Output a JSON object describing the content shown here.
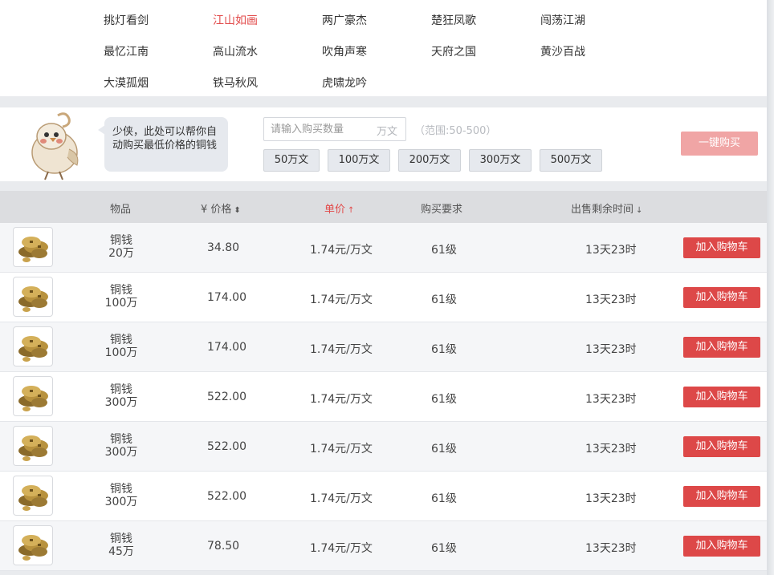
{
  "servers": [
    "挑灯看剑",
    "江山如画",
    "两广豪杰",
    "楚狂凤歌",
    "闯荡江湖",
    "最忆江南",
    "高山流水",
    "吹角声寒",
    "天府之国",
    "黄沙百战",
    "大漠孤烟",
    "铁马秋风",
    "虎啸龙吟"
  ],
  "active_server": "江山如画",
  "autobuy": {
    "tip": "少侠，此处可以帮你自动购买最低价格的铜钱",
    "placeholder": "请输入购买数量",
    "unit": "万文",
    "range": "（范围:50-500）",
    "amounts": [
      "50万文",
      "100万文",
      "200万文",
      "300万文",
      "500万文"
    ],
    "onekey_label": "一键购买"
  },
  "table": {
    "headers": {
      "item": "物品",
      "price": "¥ 价格",
      "unit_price": "单价",
      "requirement": "购买要求",
      "remaining": "出售剩余时间"
    },
    "sort_icons": {
      "price": "sort-both-icon",
      "unit_price": "sort-up-icon",
      "remaining": "sort-down-icon"
    },
    "cart_label": "加入购物车",
    "rows": [
      {
        "name": "铜钱",
        "qty": "20万",
        "price": "34.80",
        "unit_price": "1.74元/万文",
        "requirement": "61级",
        "remaining": "13天23时"
      },
      {
        "name": "铜钱",
        "qty": "100万",
        "price": "174.00",
        "unit_price": "1.74元/万文",
        "requirement": "61级",
        "remaining": "13天23时"
      },
      {
        "name": "铜钱",
        "qty": "100万",
        "price": "174.00",
        "unit_price": "1.74元/万文",
        "requirement": "61级",
        "remaining": "13天23时"
      },
      {
        "name": "铜钱",
        "qty": "300万",
        "price": "522.00",
        "unit_price": "1.74元/万文",
        "requirement": "61级",
        "remaining": "13天23时"
      },
      {
        "name": "铜钱",
        "qty": "300万",
        "price": "522.00",
        "unit_price": "1.74元/万文",
        "requirement": "61级",
        "remaining": "13天23时"
      },
      {
        "name": "铜钱",
        "qty": "300万",
        "price": "522.00",
        "unit_price": "1.74元/万文",
        "requirement": "61级",
        "remaining": "13天23时"
      },
      {
        "name": "铜钱",
        "qty": "45万",
        "price": "78.50",
        "unit_price": "1.74元/万文",
        "requirement": "61级",
        "remaining": "13天23时"
      }
    ]
  },
  "colors": {
    "accent": "#dd4848",
    "active_server": "#e24a4a",
    "onekey_disabled": "#f0a5a5"
  }
}
